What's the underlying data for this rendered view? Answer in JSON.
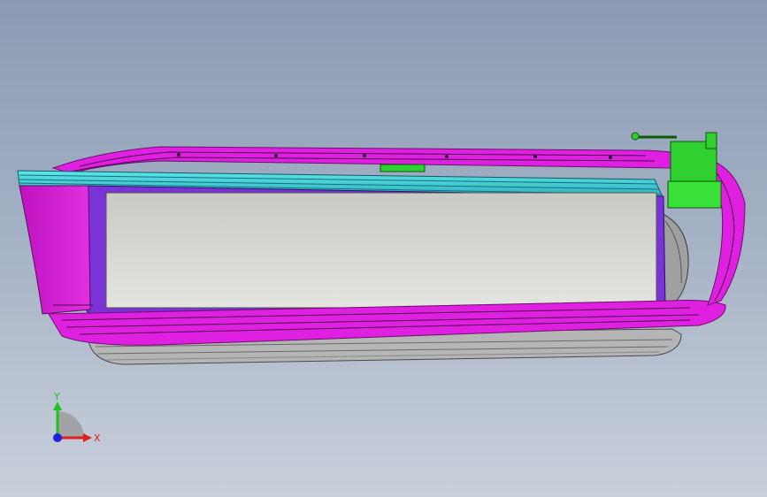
{
  "viewport": {
    "background_top": "#8b9bb3",
    "background_bottom": "#c9d0db"
  },
  "model": {
    "frame_color": "#e020e0",
    "lid_color": "#40e0e0",
    "inner_frame_color": "#7a33d6",
    "panel_color": "#e0e0dc",
    "bracket_color": "#30d030",
    "wheel_color": "#9a9a9a"
  },
  "triad": {
    "x_label": "X",
    "y_label": "Y",
    "x_color": "#e02020",
    "y_color": "#20c020",
    "z_color": "#2020e0"
  }
}
